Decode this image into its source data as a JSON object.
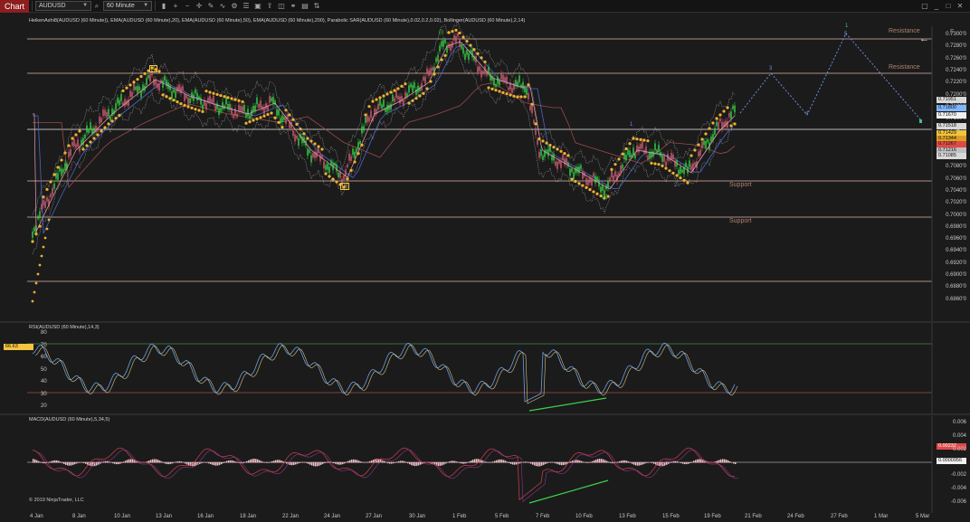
{
  "toolbar": {
    "chart_tab": "Chart",
    "instrument": "AUDUSD",
    "interval": "60 Minute"
  },
  "price_pane": {
    "title": "HeikenAshi8(AUDUSD (60 Minute)), EMA(AUDUSD (60 Minute),20), EMA(AUDUSD (60 Minute),50), EMA(AUDUSD (60 Minute),200), Parabolic SAR(AUDUSD (60 Minute),0.02,0.2,0.02), Bollinger(AUDUSD (60 Minute),2,14)",
    "y_labels": [
      "0.7300'0",
      "0.7280'0",
      "0.7260'0",
      "0.7240'0",
      "0.7220'0",
      "0.7200'0",
      "0.7180'0",
      "0.7160'0",
      "0.7140'0",
      "0.7120'0",
      "0.7100'0",
      "0.7080'0",
      "0.7060'0",
      "0.7040'0",
      "0.7020'0",
      "0.7000'0",
      "0.6980'0",
      "0.6960'0",
      "0.6940'0",
      "0.6920'0",
      "0.6900'0",
      "0.6880'0",
      "0.6860'0"
    ],
    "annotations": {
      "resistance_1": "Resistance",
      "resistance_2": "Resistance",
      "support_1": "Support",
      "support_2": "Support"
    },
    "wave_labels": {
      "w_i": "[i]",
      "w_ii": "[ii]",
      "w_paren_i": "(i)",
      "w_paren_ii": "(ii)",
      "w_1": "1",
      "w_2": "2",
      "w_3": "3",
      "w_4": "4",
      "w_5": "5",
      "w_top": "1"
    },
    "price_flags": [
      {
        "label": "0.71951",
        "color": "#d8d8d8"
      },
      {
        "label": "0.71800",
        "color": "#7fb6ff"
      },
      {
        "label": "0.71670",
        "color": "#f0f0f0"
      },
      {
        "label": "0.71518",
        "color": "#d8d8d8"
      },
      {
        "label": "0.71429",
        "color": "#f3c43f"
      },
      {
        "label": "0.71344",
        "color": "#d8a020"
      },
      {
        "label": "0.71267",
        "color": "#e04848"
      },
      {
        "label": "0.71216",
        "color": "#c0c0c0"
      },
      {
        "label": "0.71085",
        "color": "#d8d8d8"
      }
    ]
  },
  "rsi_pane": {
    "title": "RSI(AUDUSD (60 Minute),14,3)",
    "current": "66.63",
    "y_labels": [
      "80",
      "70",
      "60",
      "50",
      "40",
      "30",
      "20"
    ]
  },
  "macd_pane": {
    "title": "MACD(AUDUSD (60 Minute),5,34,5)",
    "y_labels": [
      "0.006",
      "0.004",
      "0.002",
      "-0.002",
      "-0.004",
      "-0.006"
    ],
    "flag_pos": "0.00232",
    "flag_neg": "0.0000956"
  },
  "x_labels": [
    "4 Jan",
    "8 Jan",
    "10 Jan",
    "13 Jan",
    "16 Jan",
    "18 Jan",
    "22 Jan",
    "24 Jan",
    "27 Jan",
    "30 Jan",
    "1 Feb",
    "5 Feb",
    "7 Feb",
    "10 Feb",
    "13 Feb",
    "15 Feb",
    "19 Feb",
    "21 Feb",
    "24 Feb",
    "27 Feb",
    "1 Mar",
    "5 Mar"
  ],
  "copyright": "© 2019 NinjaTrader, LLC"
}
